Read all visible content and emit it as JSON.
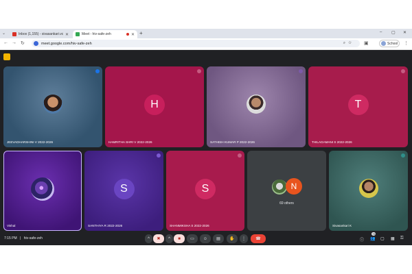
{
  "browser": {
    "tabs": [
      {
        "title": "Inbox (1,155) - sivasankari.vcet...",
        "icon": "gmail-icon",
        "color": "#d93025"
      },
      {
        "title": "Meet - hiv-safe-zeh",
        "icon": "meet-icon",
        "color": "#34a853"
      }
    ],
    "new_tab": "+",
    "window_controls": [
      "–",
      "▢",
      "✕"
    ],
    "url": "meet.google.com/hiv-safe-zeh",
    "profile": "School"
  },
  "participants": [
    {
      "name": "JEEVADHARSHINI V 2022-2026",
      "avatar": "photo",
      "bg": "#3c6181"
    },
    {
      "name": "HAMRITHA SHRI V 2022-2026",
      "avatar": "letter",
      "letter": "H",
      "bg": "#a4164b"
    },
    {
      "name": "SATHISH KUMAR P 2022-2026",
      "avatar": "photo",
      "bg": "#7e6590"
    },
    {
      "name": "THILAGAMANI S 2022-2026",
      "avatar": "letter",
      "letter": "T",
      "bg": "#a71c4c"
    },
    {
      "name": "Vishal",
      "avatar": "photo",
      "bg": "#4b1e86"
    },
    {
      "name": "SANTHIYA R 2022-2026",
      "avatar": "letter",
      "letter": "S",
      "bg": "#4a2994"
    },
    {
      "name": "SHANMIKSHA S 2022-2026",
      "avatar": "letter",
      "letter": "S",
      "bg": "#a81b4d"
    },
    {
      "name": "Sivasankari K",
      "avatar": "photo",
      "bg": "#3d6a68"
    }
  ],
  "others": {
    "count_label": "69 others",
    "letter": "N"
  },
  "controls": {
    "time": "7:15 PM",
    "separator": "|",
    "code": "hiv-safe-zeh",
    "people_count": "78"
  }
}
